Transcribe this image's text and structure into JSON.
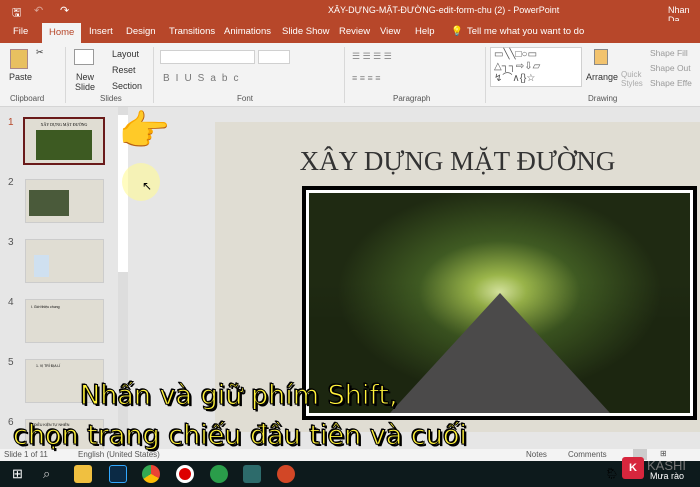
{
  "titlebar": {
    "title": "XÂY-DỰNG-MẶT-ĐƯỜNG-edit-form-chu (2)  -  PowerPoint",
    "user": "Nhan Da"
  },
  "tabs": [
    "File",
    "Home",
    "Insert",
    "Design",
    "Transitions",
    "Animations",
    "Slide Show",
    "Review",
    "View",
    "Help"
  ],
  "tell_me": "Tell me what you want to do",
  "ribbon": {
    "paste": "Paste",
    "clipboard": "Clipboard",
    "new_slide": "New Slide",
    "layout": "Layout",
    "reset": "Reset",
    "section": "Section",
    "slides": "Slides",
    "font": "Font",
    "paragraph": "Paragraph",
    "arrange": "Arrange",
    "quick_styles": "Quick Styles",
    "shape_fill": "Shape Fill",
    "shape_outline": "Shape Out",
    "shape_effects": "Shape Effe",
    "drawing": "Drawing"
  },
  "thumbnails": [
    {
      "n": "1",
      "title": "XÂY DỰNG MẶT ĐƯỜNG"
    },
    {
      "n": "2",
      "title": ""
    },
    {
      "n": "3",
      "title": ""
    },
    {
      "n": "4",
      "title": "I. Giới thiệu chung"
    },
    {
      "n": "5",
      "title": "1. VỊ TRÍ ĐỊA LÍ"
    },
    {
      "n": "6",
      "title": "ĐIỀU KIỆN TỰ NHIÊN"
    }
  ],
  "slide": {
    "title": "XÂY DỰNG MẶT ĐƯỜNG"
  },
  "status": {
    "slide": "Slide 1 of 11",
    "language": "English (United States)",
    "notes": "Notes",
    "comments": "Comments"
  },
  "caption": {
    "line1": "Nhấn và giữ phím Shift,",
    "line2": "chọn trang chiếu đầu tiên và cuối"
  },
  "taskbar": {
    "weather": "Mưa rào",
    "watermark": "KASHI"
  },
  "colors": {
    "accent": "#b7472a"
  }
}
